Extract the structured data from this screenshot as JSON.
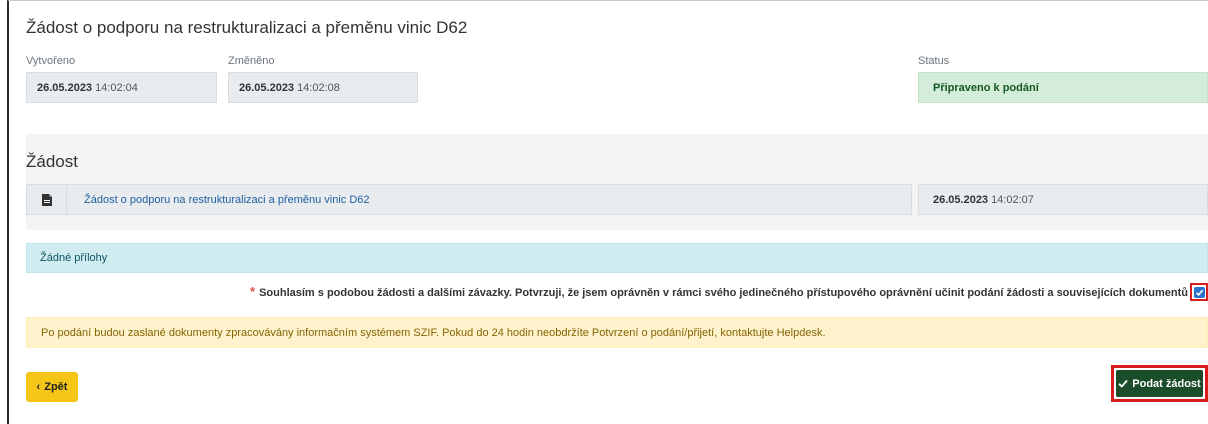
{
  "page": {
    "title": "Žádost o podporu na restrukturalizaci a přeměnu vinic D62"
  },
  "meta": {
    "created_label": "Vytvořeno",
    "created_date": "26.05.2023",
    "created_time": "14:02:04",
    "changed_label": "Změněno",
    "changed_date": "26.05.2023",
    "changed_time": "14:02:08",
    "status_label": "Status",
    "status_value": "Připraveno k podání",
    "status_color": "#d4edda"
  },
  "application": {
    "section_title": "Žádost",
    "document_icon": "pdf-file-icon",
    "document_link": "Žádost o podporu na restrukturalizaci a přeměnu vinic D62",
    "document_date": "26.05.2023",
    "document_time": "14:02:07"
  },
  "attachments": {
    "empty_text": "Žádné přílohy"
  },
  "consent": {
    "required_mark": "*",
    "text": "Souhlasím s podobou žádosti a dalšími závazky. Potvrzuji, že jsem oprávněn v rámci svého jedinečného přístupového oprávnění učinit podání žádosti a souvisejících dokumentů",
    "checked": true
  },
  "notice": {
    "text": "Po podání budou zaslané dokumenty zpracovávány informačním systémem SZIF. Pokud do 24 hodin neobdržíte Potvrzení o podání/přijetí, kontaktujte Helpdesk."
  },
  "actions": {
    "back_label": "Zpět",
    "submit_label": "Podat žádost",
    "submit_color": "#1b4d2b",
    "back_color": "#f5c518"
  }
}
